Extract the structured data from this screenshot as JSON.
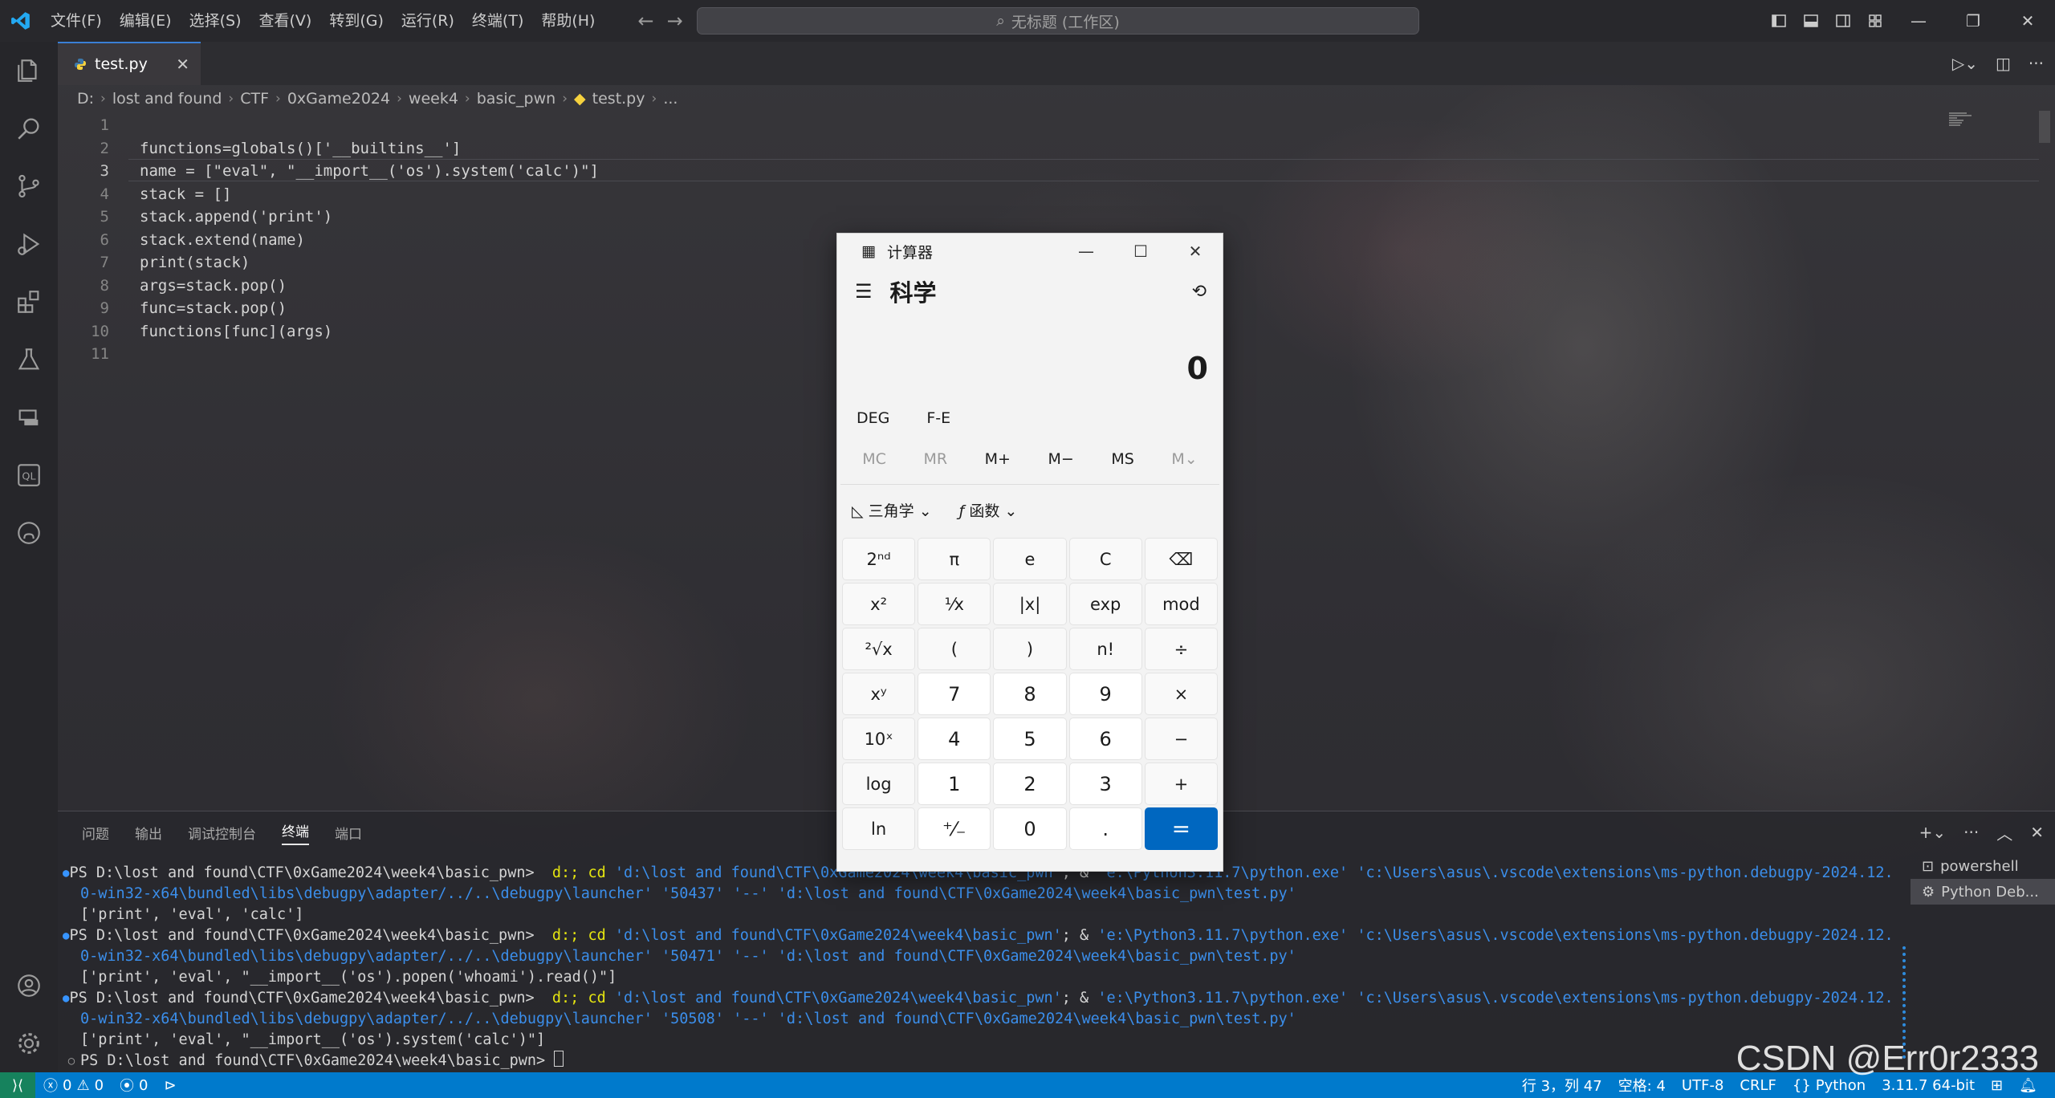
{
  "menu": [
    "文件(F)",
    "编辑(E)",
    "选择(S)",
    "查看(V)",
    "转到(G)",
    "运行(R)",
    "终端(T)",
    "帮助(H)"
  ],
  "command_center": "无标题 (工作区)",
  "tab": {
    "label": "test.py"
  },
  "breadcrumb": [
    "D:",
    "lost and found",
    "CTF",
    "0xGame2024",
    "week4",
    "basic_pwn",
    "test.py",
    "..."
  ],
  "code_lines": [
    {
      "n": "1",
      "text": ""
    },
    {
      "n": "2",
      "text": "functions=globals()['__builtins__']"
    },
    {
      "n": "3",
      "text": "name = [\"eval\", \"__import__('os').system('calc')\"]"
    },
    {
      "n": "4",
      "text": "stack = []"
    },
    {
      "n": "5",
      "text": "stack.append('print')"
    },
    {
      "n": "6",
      "text": "stack.extend(name)"
    },
    {
      "n": "7",
      "text": "print(stack)"
    },
    {
      "n": "8",
      "text": "args=stack.pop()"
    },
    {
      "n": "9",
      "text": "func=stack.pop()"
    },
    {
      "n": "10",
      "text": "functions[func](args)"
    },
    {
      "n": "11",
      "text": ""
    }
  ],
  "panel": {
    "tabs": [
      "问题",
      "输出",
      "调试控制台",
      "终端",
      "端口"
    ],
    "active_tab": "终端",
    "terminal_list": [
      "powershell",
      "Python Deb..."
    ]
  },
  "terminal": {
    "prompt": "PS D:\\lost and found\\CTF\\0xGame2024\\week4\\basic_pwn> ",
    "runs": [
      {
        "cmd_a": " d:; cd ",
        "arg_dir": "'d:\\lost and found\\CTF\\0xGame2024\\week4\\basic_pwn'",
        "amp": "; & ",
        "arg_py": "'e:\\Python3.11.7\\python.exe'",
        "arg_dbg1": " 'c:\\Users\\asus\\.vscode\\extensions\\ms-python.debugpy-2024.12.",
        "arg_dbg2": "0-win32-x64\\bundled\\libs\\debugpy\\adapter/../..\\debugpy\\launcher'",
        "port": " '50437'",
        "sep": " '--'",
        "arg_file": " 'd:\\lost and found\\CTF\\0xGame2024\\week4\\basic_pwn\\test.py'",
        "output": "['print', 'eval', 'calc']"
      },
      {
        "cmd_a": " d:; cd ",
        "arg_dir": "'d:\\lost and found\\CTF\\0xGame2024\\week4\\basic_pwn'",
        "amp": "; & ",
        "arg_py": "'e:\\Python3.11.7\\python.exe'",
        "arg_dbg1": " 'c:\\Users\\asus\\.vscode\\extensions\\ms-python.debugpy-2024.12.",
        "arg_dbg2": "0-win32-x64\\bundled\\libs\\debugpy\\adapter/../..\\debugpy\\launcher'",
        "port": " '50471'",
        "sep": " '--'",
        "arg_file": " 'd:\\lost and found\\CTF\\0xGame2024\\week4\\basic_pwn\\test.py'",
        "output": "['print', 'eval', \"__import__('os').popen('whoami').read()\"]"
      },
      {
        "cmd_a": " d:; cd ",
        "arg_dir": "'d:\\lost and found\\CTF\\0xGame2024\\week4\\basic_pwn'",
        "amp": "; & ",
        "arg_py": "'e:\\Python3.11.7\\python.exe'",
        "arg_dbg1": " 'c:\\Users\\asus\\.vscode\\extensions\\ms-python.debugpy-2024.12.",
        "arg_dbg2": "0-win32-x64\\bundled\\libs\\debugpy\\adapter/../..\\debugpy\\launcher'",
        "port": " '50508'",
        "sep": " '--'",
        "arg_file": " 'd:\\lost and found\\CTF\\0xGame2024\\week4\\basic_pwn\\test.py'",
        "output": "['print', 'eval', \"__import__('os').system('calc')\"]"
      }
    ]
  },
  "statusbar": {
    "errors": "0",
    "warnings": "0",
    "ports": "0",
    "position": "行 3，列 47",
    "spaces": "空格: 4",
    "encoding": "UTF-8",
    "eol": "CRLF",
    "language": "Python",
    "interpreter": "3.11.7 64-bit"
  },
  "watermark": "CSDN @Err0r2333",
  "calculator": {
    "title": "计算器",
    "mode": "科学",
    "display": "0",
    "flags": [
      "DEG",
      "F-E"
    ],
    "memory": [
      "MC",
      "MR",
      "M+",
      "M−",
      "MS",
      "M⌄"
    ],
    "trig": "三角学",
    "func": "函数",
    "keys": [
      [
        "2ⁿᵈ",
        "π",
        "e",
        "C",
        "⌫"
      ],
      [
        "x²",
        "¹⁄x",
        "|x|",
        "exp",
        "mod"
      ],
      [
        "²√x",
        "(",
        ")",
        "n!",
        "÷"
      ],
      [
        "xʸ",
        "7",
        "8",
        "9",
        "×"
      ],
      [
        "10ˣ",
        "4",
        "5",
        "6",
        "−"
      ],
      [
        "log",
        "1",
        "2",
        "3",
        "+"
      ],
      [
        "ln",
        "⁺⁄₋",
        "0",
        ".",
        "="
      ]
    ]
  },
  "colors": {
    "accent": "#007acc",
    "calc_equals": "#0067c0"
  }
}
